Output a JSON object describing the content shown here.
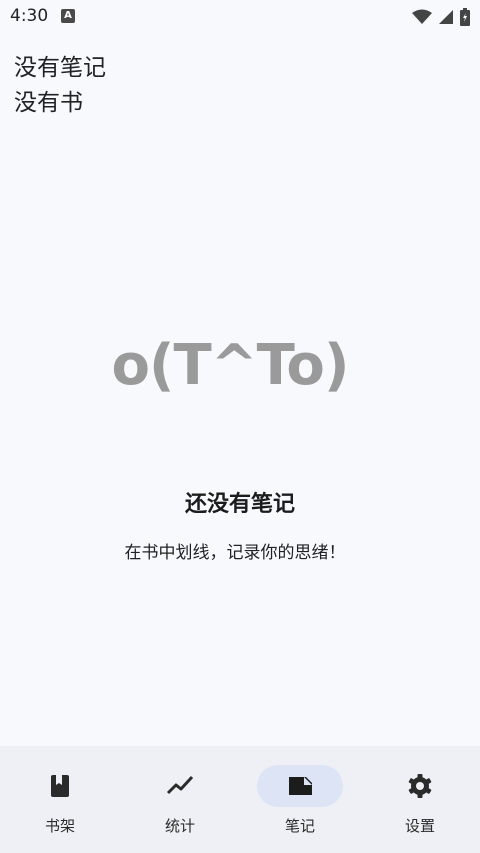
{
  "status_bar": {
    "time": "4:30",
    "notification_icon": "a-icon",
    "icons": [
      "wifi-icon",
      "signal-icon",
      "battery-icon"
    ]
  },
  "header": {
    "notes_text": "没有笔记",
    "books_text": "没有书"
  },
  "empty_state": {
    "emoticon": "o(T^To)",
    "title": "还没有笔记",
    "subtitle": "在书中划线，记录你的思绪！"
  },
  "bottom_nav": {
    "items": [
      {
        "label": "书架",
        "icon": "bookshelf-icon"
      },
      {
        "label": "统计",
        "icon": "stats-icon"
      },
      {
        "label": "笔记",
        "icon": "notes-icon",
        "active": true
      },
      {
        "label": "设置",
        "icon": "settings-icon"
      }
    ]
  },
  "colors": {
    "background": "#f8f9fd",
    "nav_background": "#eef0f5",
    "active_pill": "#dce4f6",
    "emoticon": "#9a9a9a"
  }
}
